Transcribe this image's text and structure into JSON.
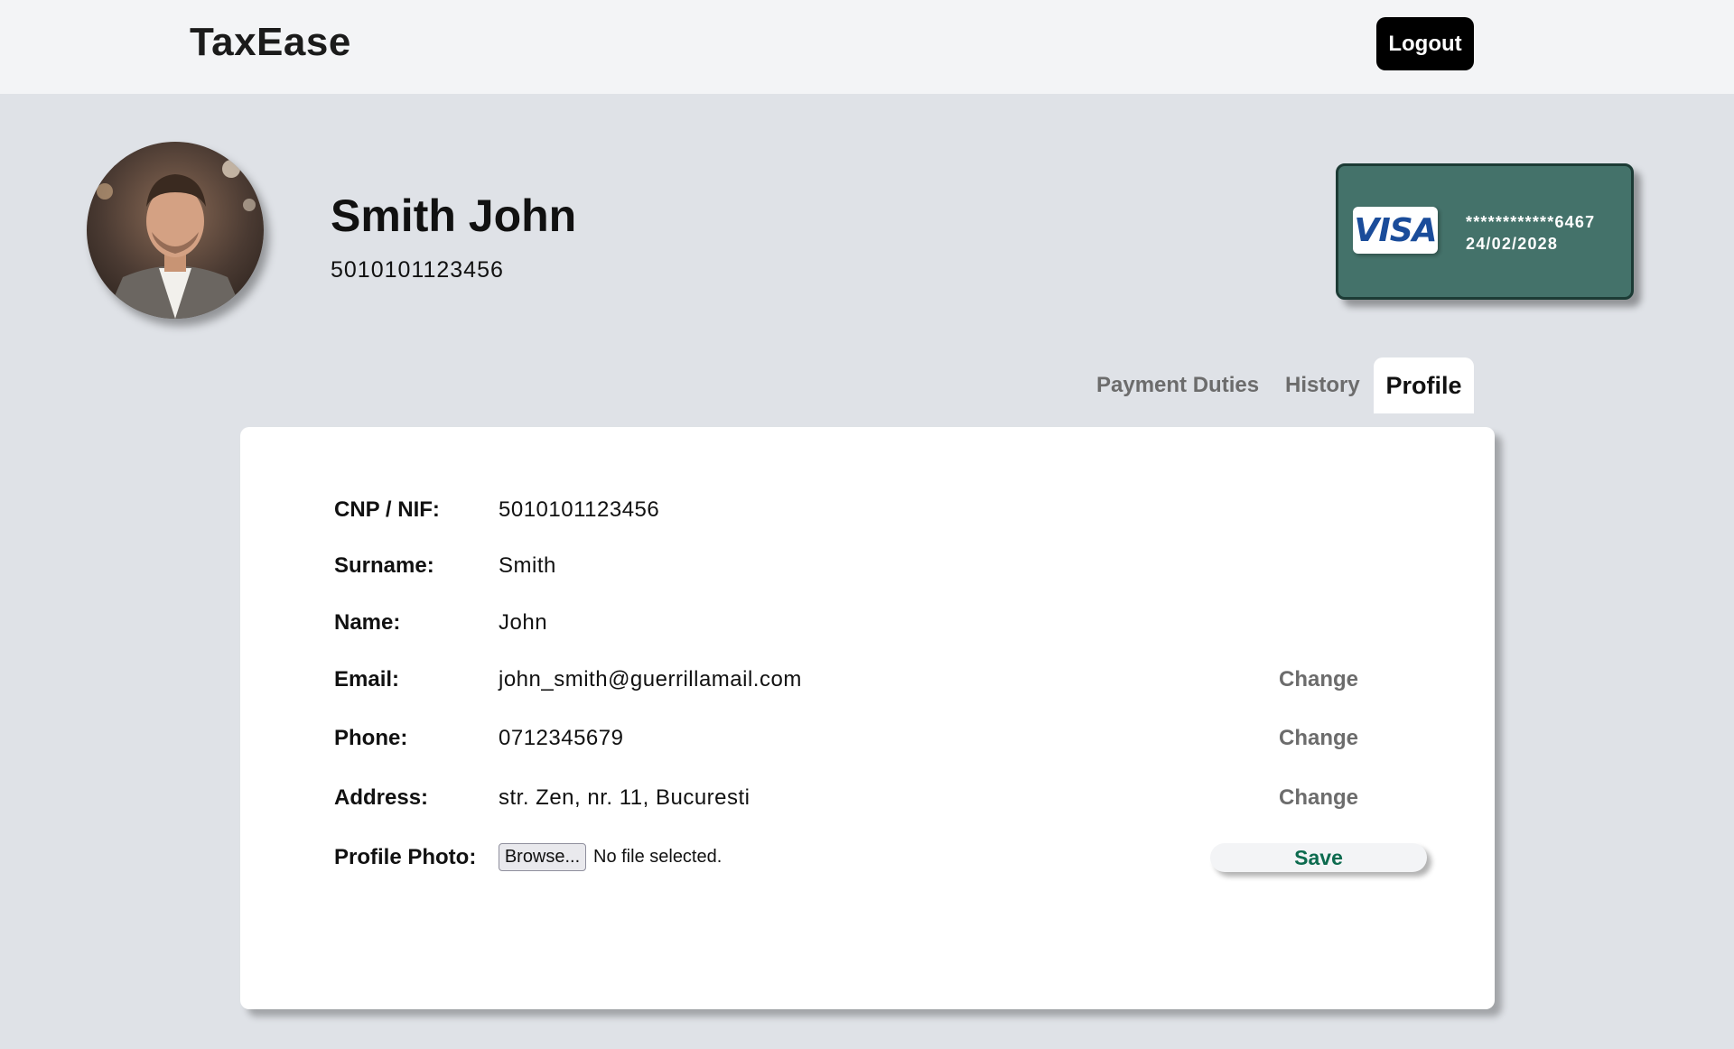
{
  "header": {
    "brand": "TaxEase",
    "logout_label": "Logout"
  },
  "user": {
    "full_name": "Smith John",
    "id_number": "5010101123456"
  },
  "card": {
    "brand": "VISA",
    "masked_number": "************6467",
    "expiry": "24/02/2028"
  },
  "tabs": [
    {
      "label": "Payment Duties",
      "active": false
    },
    {
      "label": "History",
      "active": false
    },
    {
      "label": "Profile",
      "active": true
    }
  ],
  "profile": {
    "rows": [
      {
        "label": "CNP / NIF:",
        "value": "5010101123456"
      },
      {
        "label": "Surname:",
        "value": "Smith"
      },
      {
        "label": "Name:",
        "value": "John"
      },
      {
        "label": "Email:",
        "value": "john_smith@guerrillamail.com",
        "action": "Change"
      },
      {
        "label": "Phone:",
        "value": "0712345679",
        "action": "Change"
      },
      {
        "label": "Address:",
        "value": "str. Zen, nr. 11, Bucuresti",
        "action": "Change"
      }
    ],
    "photo": {
      "label": "Profile Photo:",
      "browse_label": "Browse...",
      "file_status": "No file selected."
    },
    "save_label": "Save"
  },
  "colors": {
    "page_bg": "#dfe2e7",
    "topbar_bg": "#f3f4f6",
    "card_bg": "#44726a",
    "save_text": "#0d6b4f",
    "visa_blue": "#1a4c9a"
  }
}
